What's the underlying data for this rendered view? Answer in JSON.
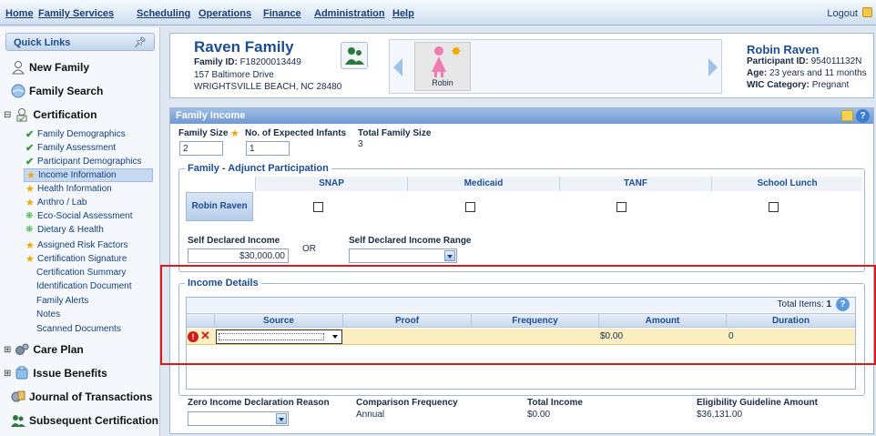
{
  "menu": {
    "items": [
      "Home",
      "Family Services",
      "Scheduling",
      "Operations",
      "Finance",
      "Administration",
      "Help"
    ],
    "logout": "Logout"
  },
  "sidebar": {
    "quick_links": "Quick Links",
    "new_family": "New Family",
    "family_search": "Family Search",
    "certification": "Certification",
    "cert_items": [
      {
        "label": "Family Demographics",
        "status": "complete"
      },
      {
        "label": "Family Assessment",
        "status": "complete"
      },
      {
        "label": "Participant Demographics",
        "status": "complete"
      },
      {
        "label": "Income Information",
        "status": "required"
      },
      {
        "label": "Health Information",
        "status": "required"
      },
      {
        "label": "Anthro / Lab",
        "status": "required"
      },
      {
        "label": "Eco-Social Assessment",
        "status": "optional"
      },
      {
        "label": "Dietary & Health",
        "status": "optional"
      },
      {
        "label": "Assigned Risk Factors",
        "status": "required"
      },
      {
        "label": "Certification Signature",
        "status": "required"
      }
    ],
    "cert_plain": [
      "Certification Summary",
      "Identification Document",
      "Family Alerts",
      "Notes",
      "Scanned Documents"
    ],
    "care_plan": "Care Plan",
    "issue_benefits": "Issue Benefits",
    "journal": "Journal of Transactions",
    "subsequent": "Subsequent Certification"
  },
  "family": {
    "name": "Raven Family",
    "id_label": "Family ID:",
    "id": "F18200013449",
    "address1": "157 Baltimore Drive",
    "address2": "WRIGHTSVILLE BEACH,  NC  28480",
    "carousel_member": "Robin"
  },
  "participant": {
    "name": "Robin Raven",
    "id_label": "Participant ID:",
    "id": "954011132N",
    "age_label": "Age:",
    "age": "23 years and 11 months",
    "wic_label": "WIC Category:",
    "wic": "Pregnant"
  },
  "income": {
    "title": "Family Income",
    "family_size_label": "Family Size",
    "expected_infants_label": "No. of Expected Infants",
    "total_family_size_label": "Total Family Size",
    "family_size": "2",
    "expected_infants": "1",
    "total_family_size": "3",
    "adjunct_title": "Family - Adjunct Participation",
    "adjunct_columns": [
      "SNAP",
      "Medicaid",
      "TANF",
      "School Lunch"
    ],
    "adjunct_row": "Robin Raven",
    "self_declared_label": "Self Declared Income",
    "self_declared": "$30,000.00",
    "or_label": "OR",
    "range_label": "Self Declared Income Range",
    "details_title": "Income Details",
    "total_items_label": "Total Items:",
    "total_items": "1",
    "grid_columns": [
      "Source",
      "Proof",
      "Frequency",
      "Amount",
      "Duration"
    ],
    "row": {
      "amount": "$0.00",
      "duration": "0"
    },
    "zero_reason_label": "Zero Income Declaration Reason",
    "comparison_label": "Comparison Frequency",
    "comparison_value": "Annual",
    "total_income_label": "Total Income",
    "total_income_value": "$0.00",
    "guideline_label": "Eligibility Guideline Amount",
    "guideline_value": "$36,131.00"
  }
}
